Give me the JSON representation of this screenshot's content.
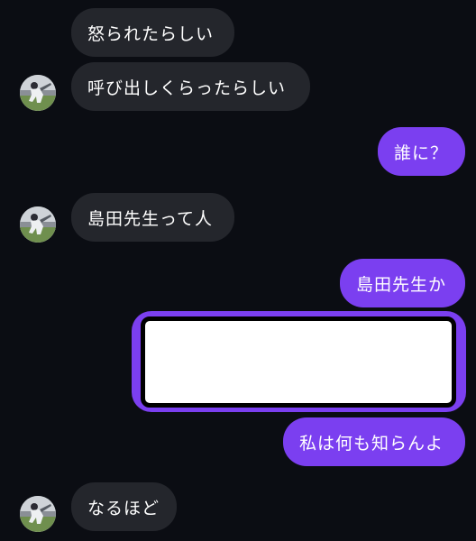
{
  "messages": [
    {
      "side": "in",
      "text": "怒られたらしい"
    },
    {
      "side": "in",
      "text": "呼び出しくらったらしい"
    },
    {
      "side": "out",
      "text": "誰に？"
    },
    {
      "side": "in",
      "text": "島田先生って人"
    },
    {
      "side": "out",
      "text": "島田先生か"
    },
    {
      "side": "out",
      "text": "",
      "redacted": true
    },
    {
      "side": "out",
      "text": "私は何も知らんよ"
    },
    {
      "side": "in",
      "text": "なるほど"
    }
  ],
  "colors": {
    "background": "#0b0d13",
    "incoming_bubble": "#24262c",
    "outgoing_bubble": "#7b3ff0",
    "text": "#ffffff"
  },
  "icons": {
    "avatar": "baseball-player-avatar-icon"
  }
}
